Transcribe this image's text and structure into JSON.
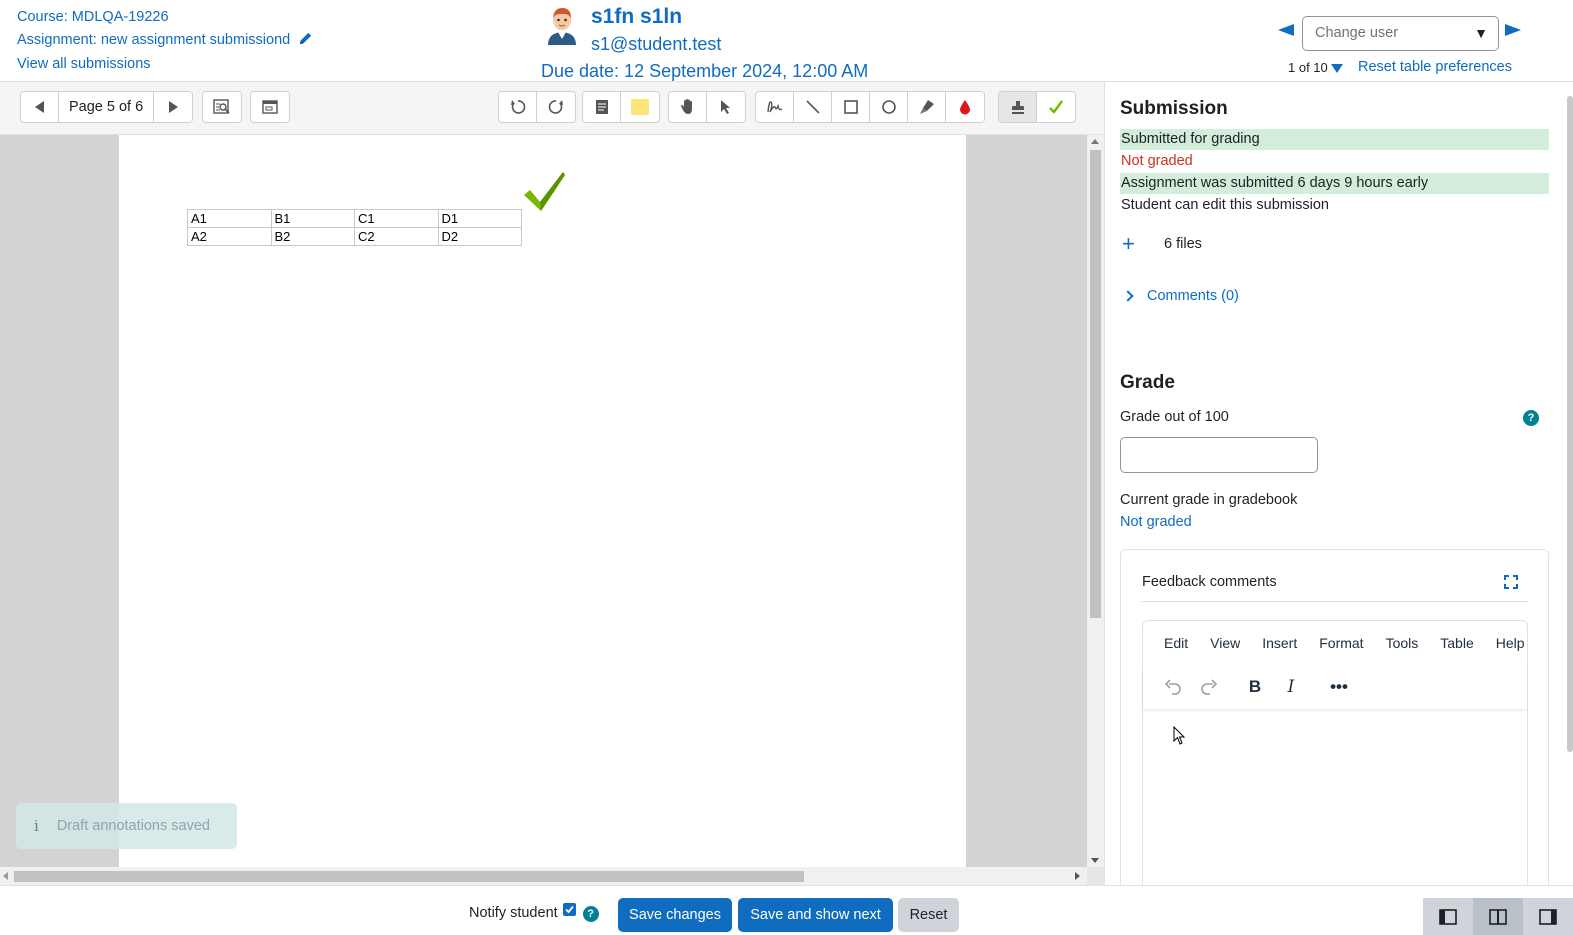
{
  "header": {
    "course_link": "Course: MDLQA-19226",
    "assignment_link": "Assignment: new assignment submissiond",
    "view_all": "View all submissions",
    "user_name": "s1fn s1ln",
    "user_email": "s1@student.test",
    "due_date": "Due date: 12 September 2024, 12:00 AM",
    "change_user_placeholder": "Change user",
    "user_count": "1 of 10",
    "reset_prefs": "Reset table preferences"
  },
  "toolbar": {
    "page_label": "Page 5 of 6",
    "buttons": [
      "prev-page",
      "next-page",
      "search-comments",
      "expand-comments",
      "rotate-left",
      "rotate-right",
      "comment",
      "comment-color",
      "pan",
      "select",
      "pen",
      "line",
      "rectangle",
      "oval",
      "highlight",
      "annotation-color",
      "stamp",
      "stamp-check"
    ],
    "colors": {
      "comment_color": "#ffe47a",
      "annotation_color": "#e0141e",
      "stamp_check": "#76b900"
    }
  },
  "document": {
    "table": [
      [
        "A1",
        "B1",
        "C1",
        "D1"
      ],
      [
        "A2",
        "B2",
        "C2",
        "D2"
      ]
    ],
    "toast": "Draft annotations saved"
  },
  "submission": {
    "title": "Submission",
    "status_submitted": "Submitted for grading",
    "status_graded": "Not graded",
    "status_timing": "Assignment was submitted 6 days 9 hours early",
    "status_edit": "Student can edit this submission",
    "files": "6 files",
    "comments": "Comments (0)"
  },
  "grade": {
    "title": "Grade",
    "grade_label": "Grade out of 100",
    "grade_value": "",
    "gradebook_label": "Current grade in gradebook",
    "gradebook_value": "Not graded"
  },
  "feedback": {
    "title": "Feedback comments",
    "menu": [
      "Edit",
      "View",
      "Insert",
      "Format",
      "Tools",
      "Table",
      "Help"
    ],
    "tools": [
      "undo-icon",
      "redo-icon",
      "bold-icon",
      "italic-icon",
      "more-icon"
    ]
  },
  "footer": {
    "notify_label": "Notify student",
    "notify_checked": true,
    "save": "Save changes",
    "save_next": "Save and show next",
    "reset": "Reset"
  },
  "colors": {
    "accent": "#0f6cbf",
    "success_bg": "#d4edda",
    "danger": "#ca3120",
    "help": "#008196"
  }
}
